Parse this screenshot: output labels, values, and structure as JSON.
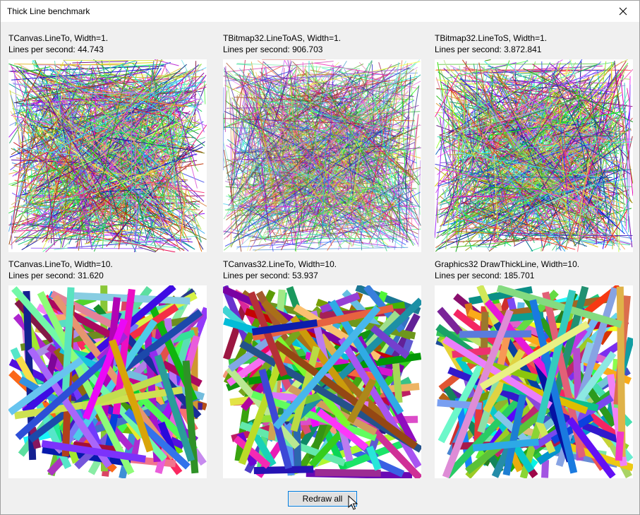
{
  "window": {
    "title": "Thick Line benchmark"
  },
  "panels": [
    {
      "name": "TCanvas.LineTo, Width=1.",
      "rate": "Lines per second: 44.743",
      "line_width": 1,
      "style": "solid"
    },
    {
      "name": "TBitmap32.LineToAS, Width=1.",
      "rate": "Lines per second: 906.703",
      "line_width": 1,
      "style": "antialiased"
    },
    {
      "name": "TBitmap32.LineToS, Width=1.",
      "rate": "Lines per second: 3.872.841",
      "line_width": 1,
      "style": "solid"
    },
    {
      "name": "TCanvas.LineTo, Width=10.",
      "rate": "Lines per second: 31.620",
      "line_width": 10,
      "style": "solid"
    },
    {
      "name": "TCanvas32.LineTo, Width=10.",
      "rate": "Lines per second: 53.937",
      "line_width": 10,
      "style": "solid"
    },
    {
      "name": "Graphics32 DrawThickLine, Width=10.",
      "rate": "Lines per second: 185.701",
      "line_width": 10,
      "style": "solid"
    }
  ],
  "buttons": {
    "redraw_label": "Redraw all"
  },
  "icons": {
    "close": "close-icon",
    "cursor": "mouse-pointer-icon"
  }
}
